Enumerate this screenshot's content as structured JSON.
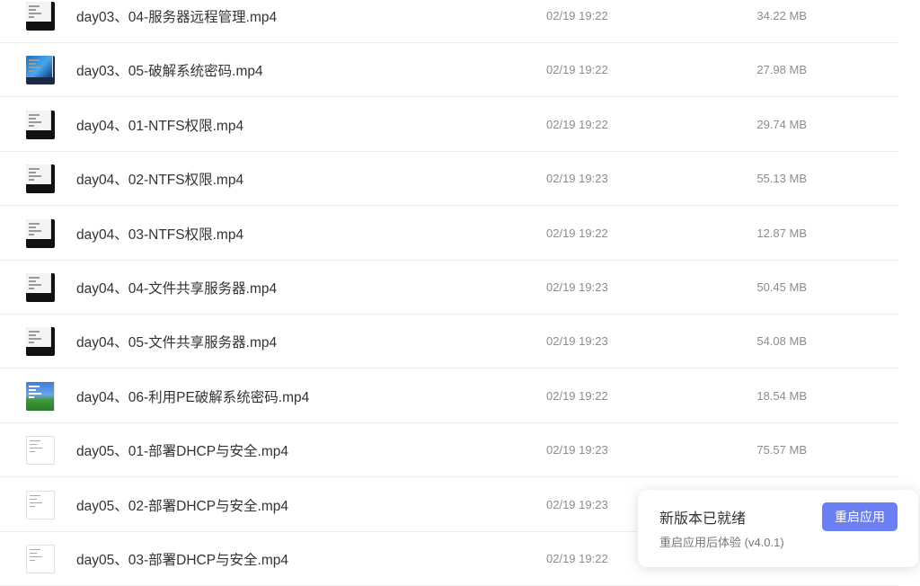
{
  "files": [
    {
      "name": "day03、04-服务器远程管理.mp4",
      "date": "02/19 19:22",
      "size": "34.22 MB",
      "thumb": "video-thumbnail-screen"
    },
    {
      "name": "day03、05-破解系统密码.mp4",
      "date": "02/19 19:22",
      "size": "27.98 MB",
      "thumb": "video-thumbnail-desktop"
    },
    {
      "name": "day04、01-NTFS权限.mp4",
      "date": "02/19 19:22",
      "size": "29.74 MB",
      "thumb": "video-thumbnail-screen"
    },
    {
      "name": "day04、02-NTFS权限.mp4",
      "date": "02/19 19:23",
      "size": "55.13 MB",
      "thumb": "video-thumbnail-screen"
    },
    {
      "name": "day04、03-NTFS权限.mp4",
      "date": "02/19 19:22",
      "size": "12.87 MB",
      "thumb": "video-thumbnail-screen"
    },
    {
      "name": "day04、04-文件共享服务器.mp4",
      "date": "02/19 19:23",
      "size": "50.45 MB",
      "thumb": "video-thumbnail-screen"
    },
    {
      "name": "day04、05-文件共享服务器.mp4",
      "date": "02/19 19:23",
      "size": "54.08 MB",
      "thumb": "video-thumbnail-screen"
    },
    {
      "name": "day04、06-利用PE破解系统密码.mp4",
      "date": "02/19 19:22",
      "size": "18.54 MB",
      "thumb": "video-thumbnail-xp"
    },
    {
      "name": "day05、01-部署DHCP与安全.mp4",
      "date": "02/19 19:23",
      "size": "75.57 MB",
      "thumb": "video-thumbnail-document"
    },
    {
      "name": "day05、02-部署DHCP与安全.mp4",
      "date": "02/19 19:23",
      "size": "",
      "thumb": "video-thumbnail-document"
    },
    {
      "name": "day05、03-部署DHCP与安全.mp4",
      "date": "02/19 19:22",
      "size": "",
      "thumb": "video-thumbnail-document"
    }
  ],
  "toast": {
    "title": "新版本已就绪",
    "subtitle": "重启应用后体验 (v4.0.1)",
    "button": "重启应用"
  },
  "colors": {
    "accent": "#6b7ff3",
    "text": "#333333",
    "muted": "#8c8c8c",
    "divider": "#eeeeee"
  }
}
